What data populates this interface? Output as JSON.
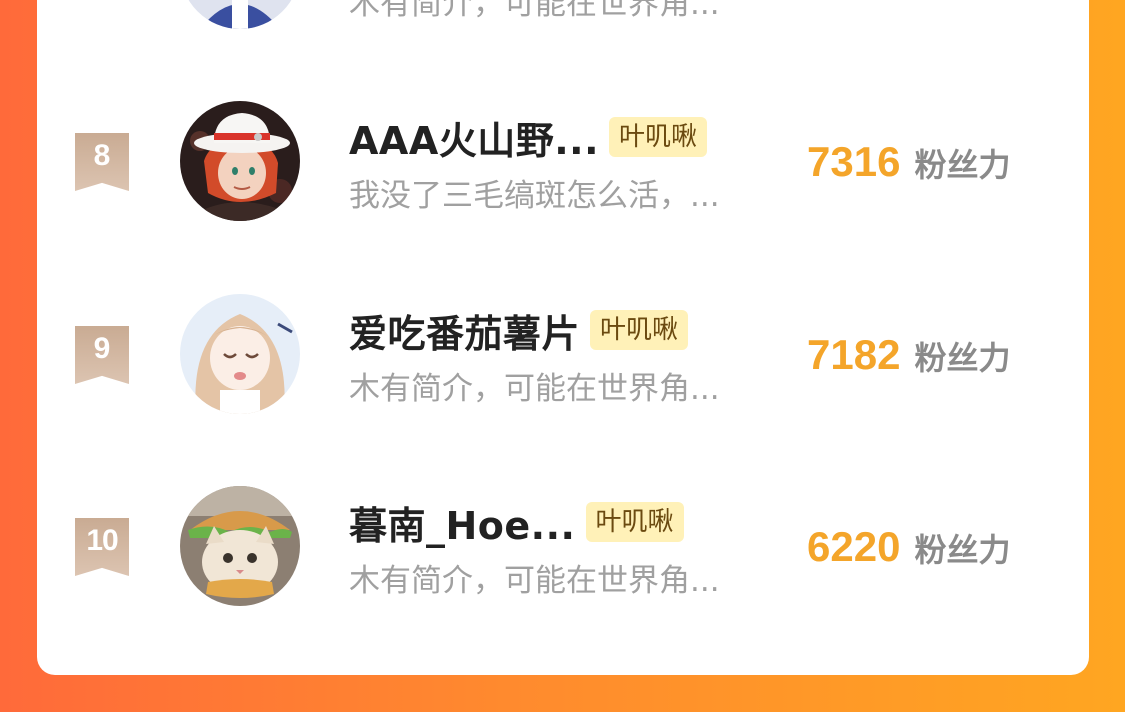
{
  "rows": [
    {
      "rank": "",
      "name": "",
      "tag": "",
      "bio": "木有简介，可能在世界角...",
      "score": "",
      "score_label": "",
      "avatar_icon": "avatar-anime-blue"
    },
    {
      "rank": "8",
      "name": "AAA火山野...",
      "tag": "叶叽啾",
      "bio": "我没了三毛缟斑怎么活，...",
      "score": "7316",
      "score_label": "粉丝力",
      "avatar_icon": "avatar-red-hair-white-hat"
    },
    {
      "rank": "9",
      "name": "爱吃番茄薯片",
      "tag": "叶叽啾",
      "bio": "木有简介，可能在世界角...",
      "score": "7182",
      "score_label": "粉丝力",
      "avatar_icon": "avatar-anime-girl"
    },
    {
      "rank": "10",
      "name": "暮南_Hoe...",
      "tag": "叶叽啾",
      "bio": "木有简介，可能在世界角...",
      "score": "6220",
      "score_label": "粉丝力",
      "avatar_icon": "avatar-cat-burger"
    }
  ],
  "colors": {
    "score": "#f4a52a",
    "tag_bg": "#fff1b8",
    "rank_badge": "#d2b7a2",
    "background_start": "#ff6a3a",
    "background_end": "#ffa621"
  }
}
